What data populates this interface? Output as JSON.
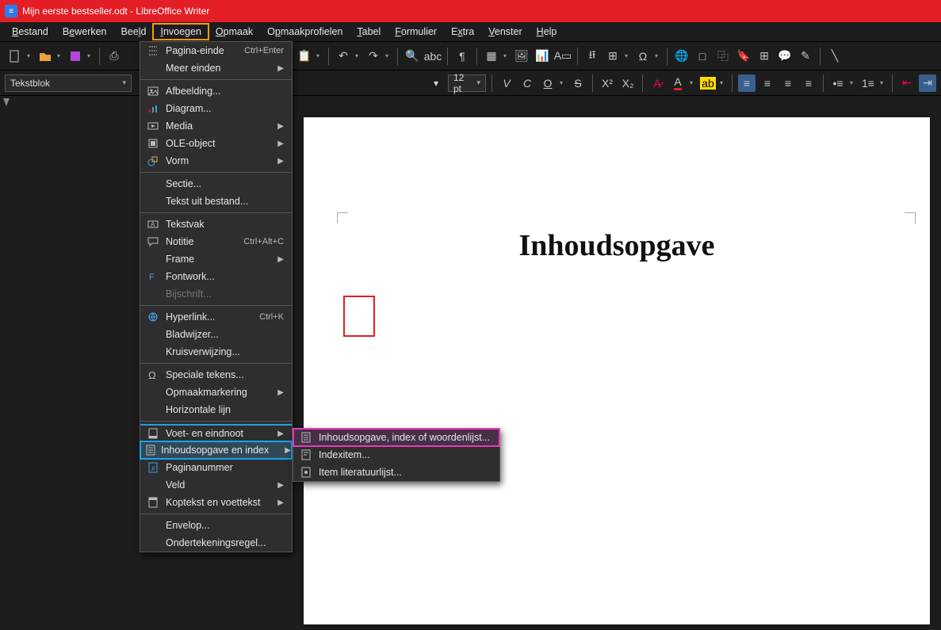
{
  "title": "Mijn eerste bestseller.odt - LibreOffice Writer",
  "menubar": [
    {
      "label": "Bestand",
      "u": "B"
    },
    {
      "label": "Bewerken",
      "u": "e"
    },
    {
      "label": "Beeld",
      "u": "l"
    },
    {
      "label": "Invoegen",
      "u": "I",
      "active": true
    },
    {
      "label": "Opmaak",
      "u": "O"
    },
    {
      "label": "Opmaakprofielen",
      "u": "p"
    },
    {
      "label": "Tabel",
      "u": "T"
    },
    {
      "label": "Formulier",
      "u": "F"
    },
    {
      "label": "Extra",
      "u": "x"
    },
    {
      "label": "Venster",
      "u": "V"
    },
    {
      "label": "Help",
      "u": "H"
    }
  ],
  "style_combo": "Tekstblok",
  "font_combo": "",
  "size_combo": "12 pt",
  "document": {
    "heading": "Inhoudsopgave"
  },
  "insert_menu": [
    {
      "icon": "page-break-icon",
      "label": "Pagina-einde",
      "shortcut": "Ctrl+Enter"
    },
    {
      "label": "Meer einden",
      "submenu": true
    },
    "---",
    {
      "icon": "image-icon",
      "label": "Afbeelding..."
    },
    {
      "icon": "chart-icon",
      "label": "Diagram..."
    },
    {
      "icon": "media-icon",
      "label": "Media",
      "submenu": true
    },
    {
      "icon": "ole-icon",
      "label": "OLE-object",
      "submenu": true
    },
    {
      "icon": "shape-icon",
      "label": "Vorm",
      "submenu": true
    },
    "---",
    {
      "label": "Sectie..."
    },
    {
      "label": "Tekst uit bestand..."
    },
    "---",
    {
      "icon": "textbox-icon",
      "label": "Tekstvak"
    },
    {
      "icon": "comment-icon",
      "label": "Notitie",
      "shortcut": "Ctrl+Alt+C"
    },
    {
      "label": "Frame",
      "submenu": true
    },
    {
      "icon": "fontwork-icon",
      "label": "Fontwork..."
    },
    {
      "label": "Bijschrift...",
      "disabled": true
    },
    "---",
    {
      "icon": "hyperlink-icon",
      "label": "Hyperlink...",
      "shortcut": "Ctrl+K"
    },
    {
      "label": "Bladwijzer..."
    },
    {
      "label": "Kruisverwijzing..."
    },
    "---",
    {
      "icon": "omega-icon",
      "label": "Speciale tekens..."
    },
    {
      "label": "Opmaakmarkering",
      "submenu": true
    },
    {
      "label": "Horizontale lijn"
    },
    "---",
    {
      "icon": "footer-icon",
      "label": "Voet- en eindnoot",
      "submenu": true,
      "hl": "blue-top"
    },
    {
      "icon": "toc-icon",
      "label": "Inhoudsopgave en index",
      "submenu": true,
      "hl": "blue"
    },
    {
      "icon": "pagenum-icon",
      "label": "Paginanummer"
    },
    {
      "label": "Veld",
      "submenu": true
    },
    {
      "icon": "header-icon",
      "label": "Koptekst en voettekst",
      "submenu": true
    },
    "---",
    {
      "label": "Envelop..."
    },
    {
      "label": "Ondertekeningsregel..."
    }
  ],
  "toc_submenu": [
    {
      "icon": "toc-dialog-icon",
      "label": "Inhoudsopgave, index of woordenlijst...",
      "hl": "pink"
    },
    {
      "icon": "index-entry-icon",
      "label": "Indexitem..."
    },
    {
      "icon": "biblio-icon",
      "label": "Item literatuurlijst..."
    }
  ]
}
